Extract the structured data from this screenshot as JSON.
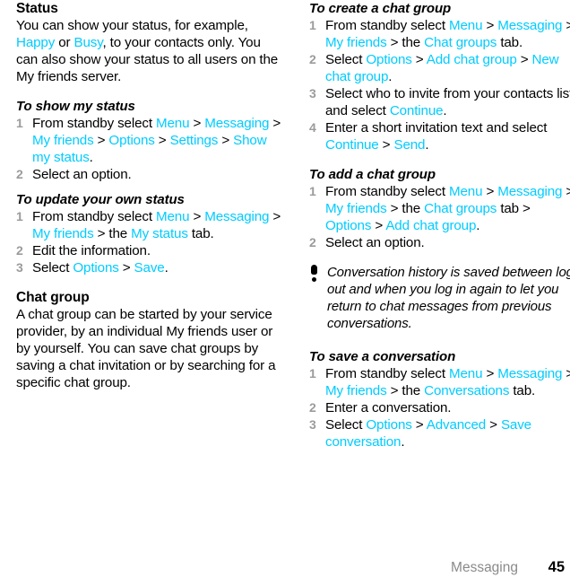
{
  "footer": {
    "chapter": "Messaging",
    "page_number": "45"
  },
  "colors": {
    "ui_link": "#00ccff",
    "step_number": "#9b9b9b",
    "footer_chapter": "#8a8a8a",
    "body_text": "#000000"
  },
  "left_column": {
    "status_section": {
      "title": "Status",
      "body_parts": [
        {
          "text": "You can show your status, for example, ",
          "style": "plain"
        },
        {
          "text": "Happy",
          "style": "ui"
        },
        {
          "text": " or ",
          "style": "plain"
        },
        {
          "text": "Busy",
          "style": "ui"
        },
        {
          "text": ", to your contacts only. You can also show your status to all users on the My friends server.",
          "style": "plain"
        }
      ]
    },
    "show_status_proc": {
      "title": "To show my status",
      "steps": [
        {
          "parts": [
            {
              "text": "From standby select ",
              "style": "plain"
            },
            {
              "text": "Menu",
              "style": "ui"
            },
            {
              "text": " > ",
              "style": "sep"
            },
            {
              "text": "Messaging",
              "style": "ui"
            },
            {
              "text": " > ",
              "style": "sep"
            },
            {
              "text": "My friends",
              "style": "ui"
            },
            {
              "text": " > ",
              "style": "sep"
            },
            {
              "text": "Options",
              "style": "ui"
            },
            {
              "text": " > ",
              "style": "sep"
            },
            {
              "text": "Settings",
              "style": "ui"
            },
            {
              "text": " > ",
              "style": "sep"
            },
            {
              "text": "Show my status",
              "style": "ui"
            },
            {
              "text": ".",
              "style": "plain"
            }
          ]
        },
        {
          "parts": [
            {
              "text": "Select an option.",
              "style": "plain"
            }
          ]
        }
      ]
    },
    "update_status_proc": {
      "title": "To update your own status",
      "steps": [
        {
          "parts": [
            {
              "text": "From standby select ",
              "style": "plain"
            },
            {
              "text": "Menu",
              "style": "ui"
            },
            {
              "text": " > ",
              "style": "sep"
            },
            {
              "text": "Messaging",
              "style": "ui"
            },
            {
              "text": " > ",
              "style": "sep"
            },
            {
              "text": "My friends",
              "style": "ui"
            },
            {
              "text": " > the ",
              "style": "sep"
            },
            {
              "text": "My status",
              "style": "ui"
            },
            {
              "text": " tab.",
              "style": "plain"
            }
          ]
        },
        {
          "parts": [
            {
              "text": "Edit the information.",
              "style": "plain"
            }
          ]
        },
        {
          "parts": [
            {
              "text": "Select ",
              "style": "plain"
            },
            {
              "text": "Options",
              "style": "ui"
            },
            {
              "text": " > ",
              "style": "sep"
            },
            {
              "text": "Save",
              "style": "ui"
            },
            {
              "text": ".",
              "style": "plain"
            }
          ]
        }
      ]
    },
    "chat_group_section": {
      "title": "Chat group",
      "body_parts": [
        {
          "text": "A chat group can be started by your service provider, by an individual My friends user or by yourself. You can save chat groups by saving a chat invitation or by searching for a specific chat group.",
          "style": "plain"
        }
      ]
    }
  },
  "right_column": {
    "create_chat_group_proc": {
      "title": "To create a chat group",
      "steps": [
        {
          "parts": [
            {
              "text": "From standby select ",
              "style": "plain"
            },
            {
              "text": "Menu",
              "style": "ui"
            },
            {
              "text": " > ",
              "style": "sep"
            },
            {
              "text": "Messaging",
              "style": "ui"
            },
            {
              "text": " > ",
              "style": "sep"
            },
            {
              "text": "My friends",
              "style": "ui"
            },
            {
              "text": " > the ",
              "style": "sep"
            },
            {
              "text": "Chat groups",
              "style": "ui"
            },
            {
              "text": " tab.",
              "style": "plain"
            }
          ]
        },
        {
          "parts": [
            {
              "text": "Select ",
              "style": "plain"
            },
            {
              "text": "Options",
              "style": "ui"
            },
            {
              "text": " > ",
              "style": "sep"
            },
            {
              "text": "Add chat group",
              "style": "ui"
            },
            {
              "text": " > ",
              "style": "sep"
            },
            {
              "text": "New chat group",
              "style": "ui"
            },
            {
              "text": ".",
              "style": "plain"
            }
          ]
        },
        {
          "parts": [
            {
              "text": "Select who to invite from your contacts list and select ",
              "style": "plain"
            },
            {
              "text": "Continue",
              "style": "ui"
            },
            {
              "text": ".",
              "style": "plain"
            }
          ]
        },
        {
          "parts": [
            {
              "text": "Enter a short invitation text and select ",
              "style": "plain"
            },
            {
              "text": "Continue",
              "style": "ui"
            },
            {
              "text": " > ",
              "style": "sep"
            },
            {
              "text": "Send",
              "style": "ui"
            },
            {
              "text": ".",
              "style": "plain"
            }
          ]
        }
      ]
    },
    "add_chat_group_proc": {
      "title": "To add a chat group",
      "steps": [
        {
          "parts": [
            {
              "text": "From standby select ",
              "style": "plain"
            },
            {
              "text": "Menu",
              "style": "ui"
            },
            {
              "text": " > ",
              "style": "sep"
            },
            {
              "text": "Messaging",
              "style": "ui"
            },
            {
              "text": " > ",
              "style": "sep"
            },
            {
              "text": "My friends",
              "style": "ui"
            },
            {
              "text": " > the ",
              "style": "sep"
            },
            {
              "text": "Chat groups",
              "style": "ui"
            },
            {
              "text": " tab > ",
              "style": "plain"
            },
            {
              "text": "Options",
              "style": "ui"
            },
            {
              "text": " > ",
              "style": "sep"
            },
            {
              "text": "Add chat group",
              "style": "ui"
            },
            {
              "text": ".",
              "style": "plain"
            }
          ]
        },
        {
          "parts": [
            {
              "text": "Select an option.",
              "style": "plain"
            }
          ]
        }
      ]
    },
    "tip_note": {
      "icon": "exclamation-tip-icon",
      "text": "Conversation history is saved between log out and when you log in again to let you return to chat messages from previous conversations."
    },
    "save_conversation_proc": {
      "title": "To save a conversation",
      "steps": [
        {
          "parts": [
            {
              "text": "From standby select ",
              "style": "plain"
            },
            {
              "text": "Menu",
              "style": "ui"
            },
            {
              "text": " > ",
              "style": "sep"
            },
            {
              "text": "Messaging",
              "style": "ui"
            },
            {
              "text": " > ",
              "style": "sep"
            },
            {
              "text": "My friends",
              "style": "ui"
            },
            {
              "text": " > the ",
              "style": "sep"
            },
            {
              "text": "Conversations",
              "style": "ui"
            },
            {
              "text": " tab.",
              "style": "plain"
            }
          ]
        },
        {
          "parts": [
            {
              "text": "Enter a conversation.",
              "style": "plain"
            }
          ]
        },
        {
          "parts": [
            {
              "text": "Select ",
              "style": "plain"
            },
            {
              "text": "Options",
              "style": "ui"
            },
            {
              "text": " > ",
              "style": "sep"
            },
            {
              "text": "Advanced",
              "style": "ui"
            },
            {
              "text": " > ",
              "style": "sep"
            },
            {
              "text": "Save conversation",
              "style": "ui"
            },
            {
              "text": ".",
              "style": "plain"
            }
          ]
        }
      ]
    }
  }
}
